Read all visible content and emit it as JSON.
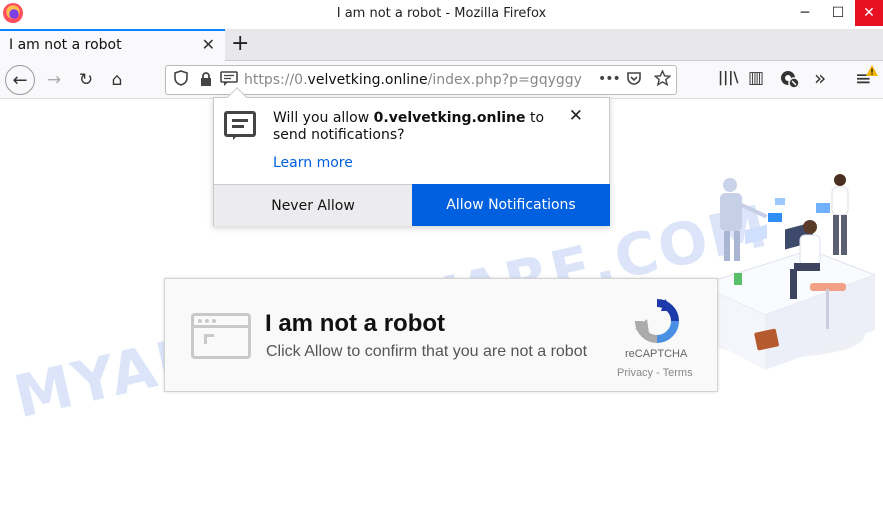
{
  "window": {
    "title": "I am not a robot - Mozilla Firefox",
    "min_icon": "─",
    "max_icon": "☐",
    "close_icon": "✕"
  },
  "tab": {
    "title": "I am not a robot",
    "close_icon": "✕",
    "new_tab_icon": "+"
  },
  "nav": {
    "back_icon": "←",
    "forward_icon": "→",
    "reload_icon": "↻",
    "home_icon": "⌂",
    "url_prefix": "https://0.",
    "url_domain": "velvetking.online",
    "url_path": "/index.php?p=gqyggy",
    "page_actions_icon": "•••",
    "toolbar": {
      "library_icon": "|||\\",
      "sidebar_icon": "▥",
      "extensions_icon": "»",
      "menu_icon": "≡"
    }
  },
  "notification": {
    "msg_prefix": "Will you allow ",
    "msg_domain": "0.velvetking.online",
    "msg_suffix": " to send notifications?",
    "learn_more": "Learn more",
    "close_icon": "✕",
    "never_allow": "Never Allow",
    "allow": "Allow Notifications"
  },
  "captcha": {
    "title": "I am not a robot",
    "subtitle": "Click Allow to confirm that you are not a robot",
    "brand": "reCAPTCHA",
    "links": "Privacy - Terms"
  },
  "watermark": "MYANTISPYWARE.COM",
  "colors": {
    "accent": "#0060df",
    "tab_accent": "#0a84ff",
    "close_red": "#e81123",
    "watermark": "#cfdcf7"
  }
}
